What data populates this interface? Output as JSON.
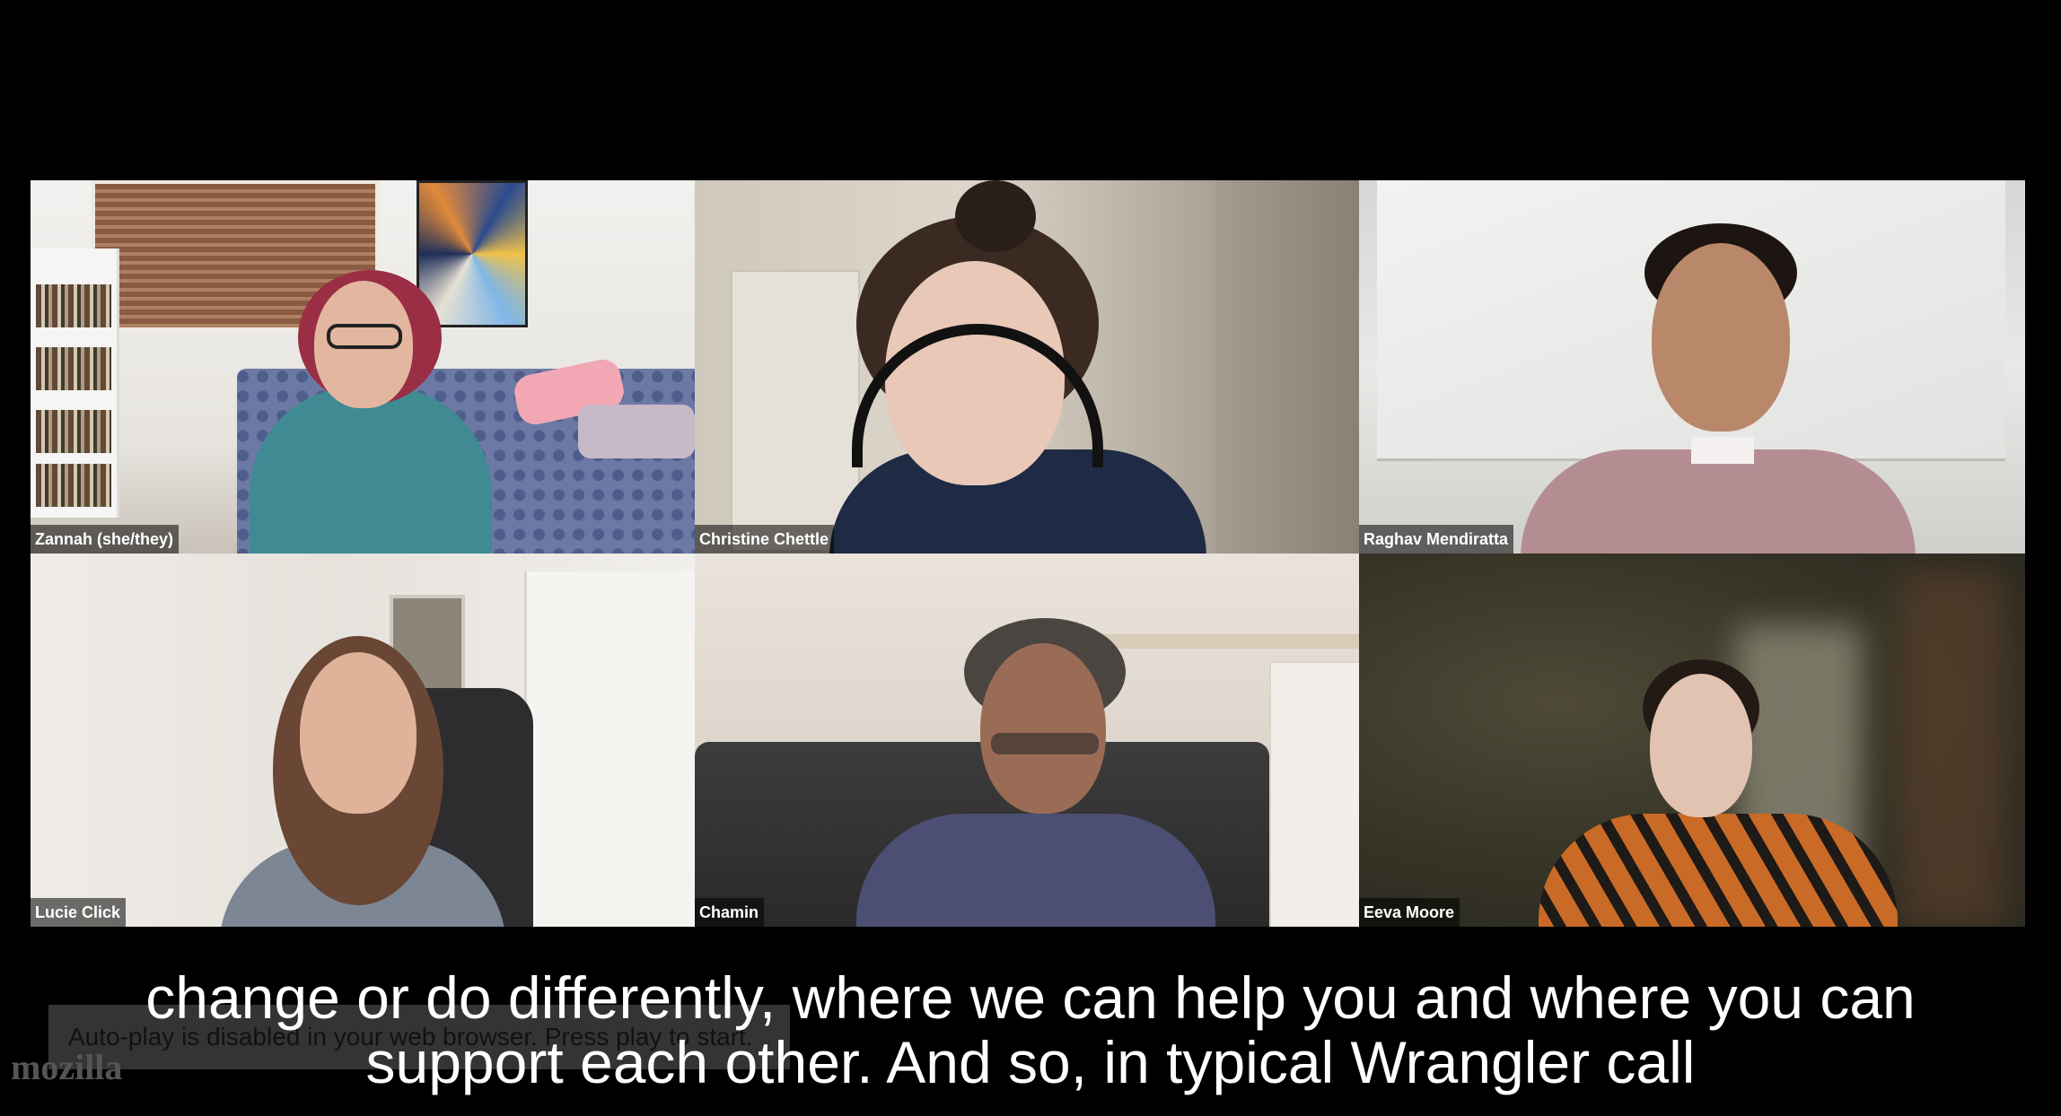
{
  "participants": [
    {
      "name": "Zannah (she/they)"
    },
    {
      "name": "Christine Chettle"
    },
    {
      "name": "Raghav Mendiratta"
    },
    {
      "name": "Lucie Click"
    },
    {
      "name": "Chamin"
    },
    {
      "name": "Eeva Moore"
    }
  ],
  "captions": {
    "line1": "change or do differently, where we can help you and where you can",
    "line2": "support each other. And so, in typical Wrangler call"
  },
  "player": {
    "autoplay_notice": "Auto-play is disabled in your web browser. Press play to start.",
    "logo_text": "mozilla"
  }
}
